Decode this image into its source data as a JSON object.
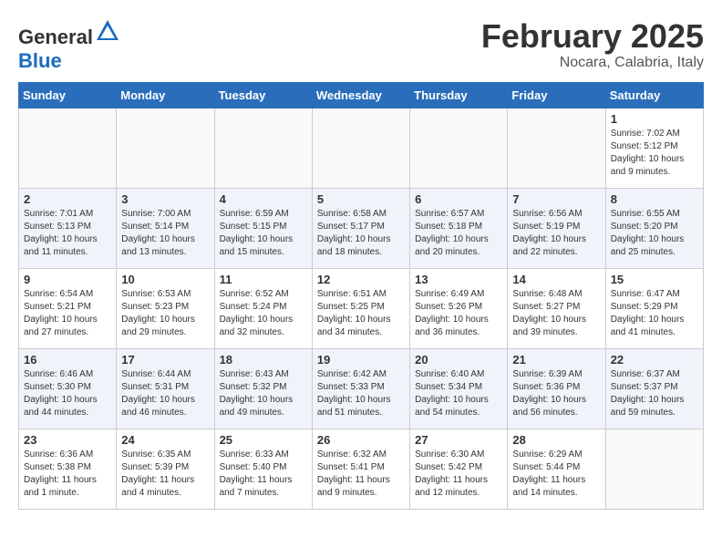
{
  "header": {
    "logo": {
      "general": "General",
      "blue": "Blue"
    },
    "month": "February 2025",
    "location": "Nocara, Calabria, Italy"
  },
  "weekdays": [
    "Sunday",
    "Monday",
    "Tuesday",
    "Wednesday",
    "Thursday",
    "Friday",
    "Saturday"
  ],
  "weeks": [
    [
      {
        "day": "",
        "info": ""
      },
      {
        "day": "",
        "info": ""
      },
      {
        "day": "",
        "info": ""
      },
      {
        "day": "",
        "info": ""
      },
      {
        "day": "",
        "info": ""
      },
      {
        "day": "",
        "info": ""
      },
      {
        "day": "1",
        "info": "Sunrise: 7:02 AM\nSunset: 5:12 PM\nDaylight: 10 hours\nand 9 minutes."
      }
    ],
    [
      {
        "day": "2",
        "info": "Sunrise: 7:01 AM\nSunset: 5:13 PM\nDaylight: 10 hours\nand 11 minutes."
      },
      {
        "day": "3",
        "info": "Sunrise: 7:00 AM\nSunset: 5:14 PM\nDaylight: 10 hours\nand 13 minutes."
      },
      {
        "day": "4",
        "info": "Sunrise: 6:59 AM\nSunset: 5:15 PM\nDaylight: 10 hours\nand 15 minutes."
      },
      {
        "day": "5",
        "info": "Sunrise: 6:58 AM\nSunset: 5:17 PM\nDaylight: 10 hours\nand 18 minutes."
      },
      {
        "day": "6",
        "info": "Sunrise: 6:57 AM\nSunset: 5:18 PM\nDaylight: 10 hours\nand 20 minutes."
      },
      {
        "day": "7",
        "info": "Sunrise: 6:56 AM\nSunset: 5:19 PM\nDaylight: 10 hours\nand 22 minutes."
      },
      {
        "day": "8",
        "info": "Sunrise: 6:55 AM\nSunset: 5:20 PM\nDaylight: 10 hours\nand 25 minutes."
      }
    ],
    [
      {
        "day": "9",
        "info": "Sunrise: 6:54 AM\nSunset: 5:21 PM\nDaylight: 10 hours\nand 27 minutes."
      },
      {
        "day": "10",
        "info": "Sunrise: 6:53 AM\nSunset: 5:23 PM\nDaylight: 10 hours\nand 29 minutes."
      },
      {
        "day": "11",
        "info": "Sunrise: 6:52 AM\nSunset: 5:24 PM\nDaylight: 10 hours\nand 32 minutes."
      },
      {
        "day": "12",
        "info": "Sunrise: 6:51 AM\nSunset: 5:25 PM\nDaylight: 10 hours\nand 34 minutes."
      },
      {
        "day": "13",
        "info": "Sunrise: 6:49 AM\nSunset: 5:26 PM\nDaylight: 10 hours\nand 36 minutes."
      },
      {
        "day": "14",
        "info": "Sunrise: 6:48 AM\nSunset: 5:27 PM\nDaylight: 10 hours\nand 39 minutes."
      },
      {
        "day": "15",
        "info": "Sunrise: 6:47 AM\nSunset: 5:29 PM\nDaylight: 10 hours\nand 41 minutes."
      }
    ],
    [
      {
        "day": "16",
        "info": "Sunrise: 6:46 AM\nSunset: 5:30 PM\nDaylight: 10 hours\nand 44 minutes."
      },
      {
        "day": "17",
        "info": "Sunrise: 6:44 AM\nSunset: 5:31 PM\nDaylight: 10 hours\nand 46 minutes."
      },
      {
        "day": "18",
        "info": "Sunrise: 6:43 AM\nSunset: 5:32 PM\nDaylight: 10 hours\nand 49 minutes."
      },
      {
        "day": "19",
        "info": "Sunrise: 6:42 AM\nSunset: 5:33 PM\nDaylight: 10 hours\nand 51 minutes."
      },
      {
        "day": "20",
        "info": "Sunrise: 6:40 AM\nSunset: 5:34 PM\nDaylight: 10 hours\nand 54 minutes."
      },
      {
        "day": "21",
        "info": "Sunrise: 6:39 AM\nSunset: 5:36 PM\nDaylight: 10 hours\nand 56 minutes."
      },
      {
        "day": "22",
        "info": "Sunrise: 6:37 AM\nSunset: 5:37 PM\nDaylight: 10 hours\nand 59 minutes."
      }
    ],
    [
      {
        "day": "23",
        "info": "Sunrise: 6:36 AM\nSunset: 5:38 PM\nDaylight: 11 hours\nand 1 minute."
      },
      {
        "day": "24",
        "info": "Sunrise: 6:35 AM\nSunset: 5:39 PM\nDaylight: 11 hours\nand 4 minutes."
      },
      {
        "day": "25",
        "info": "Sunrise: 6:33 AM\nSunset: 5:40 PM\nDaylight: 11 hours\nand 7 minutes."
      },
      {
        "day": "26",
        "info": "Sunrise: 6:32 AM\nSunset: 5:41 PM\nDaylight: 11 hours\nand 9 minutes."
      },
      {
        "day": "27",
        "info": "Sunrise: 6:30 AM\nSunset: 5:42 PM\nDaylight: 11 hours\nand 12 minutes."
      },
      {
        "day": "28",
        "info": "Sunrise: 6:29 AM\nSunset: 5:44 PM\nDaylight: 11 hours\nand 14 minutes."
      },
      {
        "day": "",
        "info": ""
      }
    ]
  ]
}
